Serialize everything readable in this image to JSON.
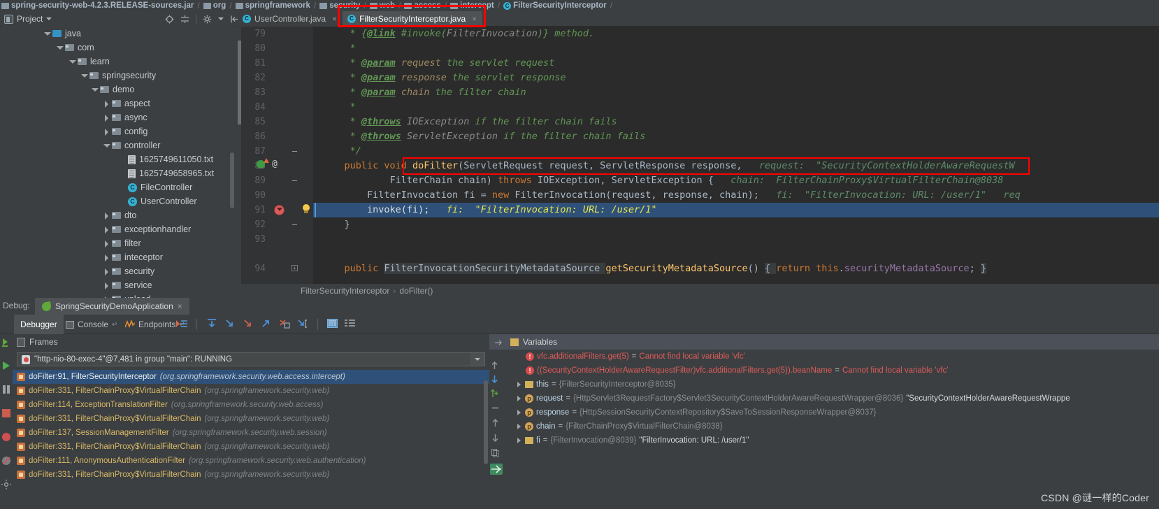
{
  "navigation_bar": {
    "crumbs": [
      {
        "icon": "jar-icon",
        "label": "spring-security-web-4.2.3.RELEASE-sources.jar"
      },
      {
        "icon": "folder-icon",
        "label": "org"
      },
      {
        "icon": "folder-icon",
        "label": "springframework"
      },
      {
        "icon": "folder-icon",
        "label": "security"
      },
      {
        "icon": "folder-icon",
        "label": "web"
      },
      {
        "icon": "folder-icon",
        "label": "access"
      },
      {
        "icon": "folder-icon",
        "label": "intercept"
      },
      {
        "icon": "class-icon",
        "label": "FilterSecurityInterceptor"
      }
    ]
  },
  "toolbar": {
    "project_label": "Project",
    "icons": [
      "locate-icon",
      "collapse-all-icon",
      "settings-gear-icon",
      "hide-panel-icon"
    ]
  },
  "editor_tabs": [
    {
      "label": "UserController.java",
      "icon": "class-icon",
      "active": false,
      "close": "×"
    },
    {
      "label": "FilterSecurityInterceptor.java",
      "icon": "class-icon",
      "active": true,
      "close": "×",
      "highlighted": true
    }
  ],
  "project_tree": [
    {
      "indent": 2,
      "twisty": "down",
      "icon": "source-folder-icon",
      "label": "java"
    },
    {
      "indent": 3,
      "twisty": "down",
      "icon": "folder-icon",
      "label": "com"
    },
    {
      "indent": 4,
      "twisty": "down",
      "icon": "folder-icon",
      "label": "learn"
    },
    {
      "indent": 5,
      "twisty": "down",
      "icon": "folder-icon",
      "label": "springsecurity"
    },
    {
      "indent": 6,
      "twisty": "down",
      "icon": "folder-icon",
      "label": "demo"
    },
    {
      "indent": 7,
      "twisty": "right",
      "icon": "folder-icon",
      "label": "aspect"
    },
    {
      "indent": 7,
      "twisty": "right",
      "icon": "folder-icon",
      "label": "async"
    },
    {
      "indent": 7,
      "twisty": "right",
      "icon": "folder-icon",
      "label": "config"
    },
    {
      "indent": 7,
      "twisty": "down",
      "icon": "folder-icon",
      "label": "controller"
    },
    {
      "indent": 9,
      "twisty": "none",
      "icon": "text-file-icon",
      "label": "1625749611050.txt"
    },
    {
      "indent": 9,
      "twisty": "none",
      "icon": "text-file-icon",
      "label": "1625749658965.txt"
    },
    {
      "indent": 9,
      "twisty": "none",
      "icon": "class-icon",
      "label": "FileController"
    },
    {
      "indent": 9,
      "twisty": "none",
      "icon": "class-icon",
      "label": "UserController"
    },
    {
      "indent": 7,
      "twisty": "right",
      "icon": "folder-icon",
      "label": "dto"
    },
    {
      "indent": 7,
      "twisty": "right",
      "icon": "folder-icon",
      "label": "exceptionhandler"
    },
    {
      "indent": 7,
      "twisty": "right",
      "icon": "folder-icon",
      "label": "filter"
    },
    {
      "indent": 7,
      "twisty": "right",
      "icon": "folder-icon",
      "label": "inteceptor"
    },
    {
      "indent": 7,
      "twisty": "right",
      "icon": "folder-icon",
      "label": "security"
    },
    {
      "indent": 7,
      "twisty": "right",
      "icon": "folder-icon",
      "label": "service"
    },
    {
      "indent": 7,
      "twisty": "right",
      "icon": "folder-icon",
      "label": "upload"
    }
  ],
  "code": {
    "first_line_number": 79,
    "lines": [
      {
        "n": 79,
        "text": "     * {@link #invoke(FilterInvocation)} method."
      },
      {
        "n": 80,
        "text": "     *"
      },
      {
        "n": 81,
        "text": "     * @param request the servlet request"
      },
      {
        "n": 82,
        "text": "     * @param response the servlet response"
      },
      {
        "n": 83,
        "text": "     * @param chain the filter chain"
      },
      {
        "n": 84,
        "text": "     *"
      },
      {
        "n": 85,
        "text": "     * @throws IOException if the filter chain fails"
      },
      {
        "n": 86,
        "text": "     * @throws ServletException if the filter chain fails"
      },
      {
        "n": 87,
        "text": "     */"
      },
      {
        "n": 88,
        "text": "    public void doFilter(ServletRequest request, ServletResponse response,"
      },
      {
        "n": 89,
        "text": "            FilterChain chain) throws IOException, ServletException {"
      },
      {
        "n": 90,
        "text": "        FilterInvocation fi = new FilterInvocation(request, response, chain);"
      },
      {
        "n": 91,
        "text": "        invoke(fi);"
      },
      {
        "n": 92,
        "text": "    }"
      },
      {
        "n": 93,
        "text": ""
      },
      {
        "n": 94,
        "text": "    public FilterInvocationSecurityMetadataSource getSecurityMetadataSource() { return this.securityMetadataSource; }"
      }
    ],
    "inline_hints": {
      "line88": "request:  \"SecurityContextHolderAwareRequestW",
      "line89": "chain:  FilterChainProxy$VirtualFilterChain@8038",
      "line90": "fi:  \"FilterInvocation: URL: /user/1\"   req",
      "line91": "fi:  \"FilterInvocation: URL: /user/1\""
    },
    "highlighted_line": 91,
    "breakpoint_line": 91,
    "gutter_marks": {
      "line88": "override-and-annotation",
      "line91": "breakpoint-and-intention-bulb"
    }
  },
  "editor_breadcrumb": {
    "class": "FilterSecurityInterceptor",
    "separator": "›",
    "method": "doFilter()"
  },
  "debug_window": {
    "label": "Debug:",
    "run_config": "SpringSecurityDemoApplication",
    "run_config_icon": "spring-leaf-icon",
    "close": "×",
    "tabs": [
      {
        "label": "Debugger",
        "selected": true,
        "icon": null
      },
      {
        "label": "Console",
        "selected": false,
        "icon": "console-icon",
        "pin": "↵"
      },
      {
        "label": "Endpoints",
        "selected": false,
        "icon": "endpoints-icon",
        "pin": "↵"
      }
    ],
    "actions": [
      "show-execution-point-icon",
      "step-over-icon",
      "step-into-icon",
      "force-step-into-icon",
      "step-out-icon",
      "drop-frame-icon",
      "run-to-cursor-icon",
      "evaluate-expression-icon",
      "layout-icon"
    ]
  },
  "frames_panel": {
    "title": "Frames",
    "thread": "\"http-nio-80-exec-4\"@7,481 in group \"main\": RUNNING",
    "frames": [
      {
        "method": "doFilter:91, FilterSecurityInterceptor",
        "package": "(org.springframework.security.web.access.intercept)",
        "selected": true
      },
      {
        "method": "doFilter:331, FilterChainProxy$VirtualFilterChain",
        "package": "(org.springframework.security.web)",
        "selected": false
      },
      {
        "method": "doFilter:114, ExceptionTranslationFilter",
        "package": "(org.springframework.security.web.access)",
        "selected": false
      },
      {
        "method": "doFilter:331, FilterChainProxy$VirtualFilterChain",
        "package": "(org.springframework.security.web)",
        "selected": false
      },
      {
        "method": "doFilter:137, SessionManagementFilter",
        "package": "(org.springframework.security.web.session)",
        "selected": false
      },
      {
        "method": "doFilter:331, FilterChainProxy$VirtualFilterChain",
        "package": "(org.springframework.security.web)",
        "selected": false
      },
      {
        "method": "doFilter:111, AnonymousAuthenticationFilter",
        "package": "(org.springframework.security.web.authentication)",
        "selected": false
      },
      {
        "method": "doFilter:331, FilterChainProxy$VirtualFilterChain",
        "package": "(org.springframework.security.web)",
        "selected": false
      }
    ]
  },
  "variables_panel": {
    "title": "Variables",
    "rows": [
      {
        "icon": "error-icon",
        "name": "vfc.additionalFilters.get(5)",
        "eq": "=",
        "value": "Cannot find local variable 'vfc'",
        "value_kind": "error",
        "twisty": false
      },
      {
        "icon": "error-icon",
        "name": "((SecurityContextHolderAwareRequestFilter)vfc.additionalFilters.get(5)).beanName",
        "eq": "=",
        "value": "Cannot find local variable 'vfc'",
        "value_kind": "error",
        "twisty": false
      },
      {
        "icon": "object-icon",
        "name": "this",
        "eq": "=",
        "value": "{FilterSecurityInterceptor@8035}",
        "value_kind": "object",
        "twisty": true
      },
      {
        "icon": "param-icon",
        "name": "request",
        "eq": "=",
        "value": "{HttpServlet3RequestFactory$Servlet3SecurityContextHolderAwareRequestWrapper@8036}",
        "extra": "\"SecurityContextHolderAwareRequestWrappe",
        "value_kind": "object",
        "twisty": true
      },
      {
        "icon": "param-icon",
        "name": "response",
        "eq": "=",
        "value": "{HttpSessionSecurityContextRepository$SaveToSessionResponseWrapper@8037}",
        "value_kind": "object",
        "twisty": true
      },
      {
        "icon": "param-icon",
        "name": "chain",
        "eq": "=",
        "value": "{FilterChainProxy$VirtualFilterChain@8038}",
        "value_kind": "object",
        "twisty": true
      },
      {
        "icon": "object-icon",
        "name": "fi",
        "eq": "=",
        "value": "{FilterInvocation@8039}",
        "extra": "\"FilterInvocation: URL: /user/1\"",
        "value_kind": "object",
        "twisty": true
      }
    ]
  },
  "watermark": "CSDN @谜一样的Coder",
  "colors": {
    "accent_blue": "#4a88c7",
    "selection_blue": "#2f5179",
    "highlight_red": "#ff0000",
    "keyword_orange": "#cc7832",
    "string_green": "#6a8759",
    "comment_green": "#629755",
    "method_yellow": "#ffc66d"
  }
}
